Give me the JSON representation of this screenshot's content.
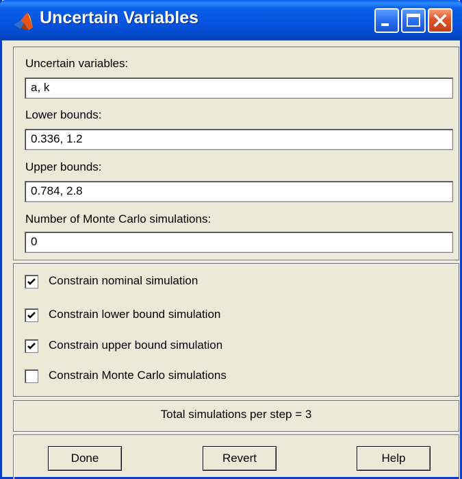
{
  "window": {
    "title": "Uncertain Variables"
  },
  "fields": {
    "uncertain_variables": {
      "label": "Uncertain variables:",
      "value": "a, k"
    },
    "lower_bounds": {
      "label": "Lower bounds:",
      "value": "0.336, 1.2"
    },
    "upper_bounds": {
      "label": "Upper bounds:",
      "value": "0.784, 2.8"
    },
    "monte_carlo": {
      "label": "Number of Monte Carlo simulations:",
      "value": "0"
    }
  },
  "constraints": [
    {
      "label": "Constrain nominal simulation",
      "checked": true
    },
    {
      "label": "Constrain lower bound simulation",
      "checked": true
    },
    {
      "label": "Constrain upper bound simulation",
      "checked": true
    },
    {
      "label": "Constrain Monte Carlo simulations",
      "checked": false
    }
  ],
  "status": {
    "text": "Total simulations per step = 3"
  },
  "buttons": {
    "done": "Done",
    "revert": "Revert",
    "help": "Help"
  },
  "icons": {
    "app": "matlab-icon",
    "minimize": "minimize-icon",
    "maximize": "maximize-icon",
    "close": "close-icon",
    "check": "checkmark-icon"
  },
  "colors": {
    "titlebar": "#0553de",
    "dialog_bg": "#ece9d8",
    "close_button": "#e0542a"
  }
}
